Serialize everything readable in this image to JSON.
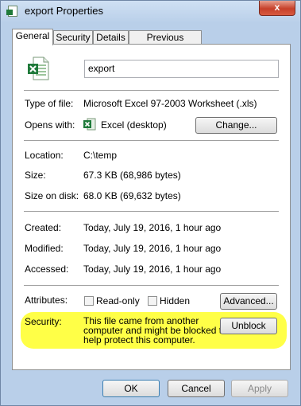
{
  "window": {
    "title": "export Properties",
    "close_glyph": "x"
  },
  "tabs": [
    {
      "label": "General",
      "active": true
    },
    {
      "label": "Security"
    },
    {
      "label": "Details"
    },
    {
      "label": "Previous Versions"
    }
  ],
  "file": {
    "name": "export",
    "icon": "excel-file-icon"
  },
  "rows": {
    "type_label": "Type of file:",
    "type_value": "Microsoft Excel 97-2003 Worksheet (.xls)",
    "opens_label": "Opens with:",
    "opens_value": "Excel (desktop)",
    "change_button": "Change...",
    "location_label": "Location:",
    "location_value": "C:\\temp",
    "size_label": "Size:",
    "size_value": "67.3 KB (68,986 bytes)",
    "size_disk_label": "Size on disk:",
    "size_disk_value": "68.0 KB (69,632 bytes)",
    "created_label": "Created:",
    "created_value": "Today, July 19, 2016, 1 hour ago",
    "modified_label": "Modified:",
    "modified_value": "Today, July 19, 2016, 1 hour ago",
    "accessed_label": "Accessed:",
    "accessed_value": "Today, July 19, 2016, 1 hour ago",
    "attributes_label": "Attributes:",
    "readonly_label": "Read-only",
    "hidden_label": "Hidden",
    "advanced_button": "Advanced...",
    "security_label": "Security:",
    "security_line1": "This file came from another",
    "security_line2": "computer and might be blocked to",
    "security_line3": "help protect this computer.",
    "unblock_button": "Unblock"
  },
  "footer": {
    "ok": "OK",
    "cancel": "Cancel",
    "apply": "Apply"
  },
  "colors": {
    "highlight": "#ffff33",
    "excel_green": "#1f7a3a"
  }
}
